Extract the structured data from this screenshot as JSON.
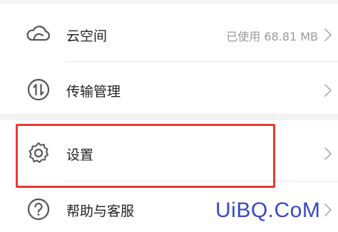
{
  "menu": {
    "items": [
      {
        "label": "云空间",
        "value": "已使用 68.81 MB",
        "icon": "cloud-icon"
      },
      {
        "label": "传输管理",
        "value": "",
        "icon": "transfer-icon"
      },
      {
        "label": "设置",
        "value": "",
        "icon": "gear-icon"
      },
      {
        "label": "帮助与客服",
        "value": "",
        "icon": "help-icon"
      }
    ]
  },
  "highlight_color": "#e53935",
  "watermark": {
    "text": "UiBQ.CoM",
    "color": "#3949c4"
  },
  "colors": {
    "text": "#222222",
    "secondary_text": "#9a9a9a",
    "icon": "#555555",
    "divider": "#e8e8e8"
  }
}
